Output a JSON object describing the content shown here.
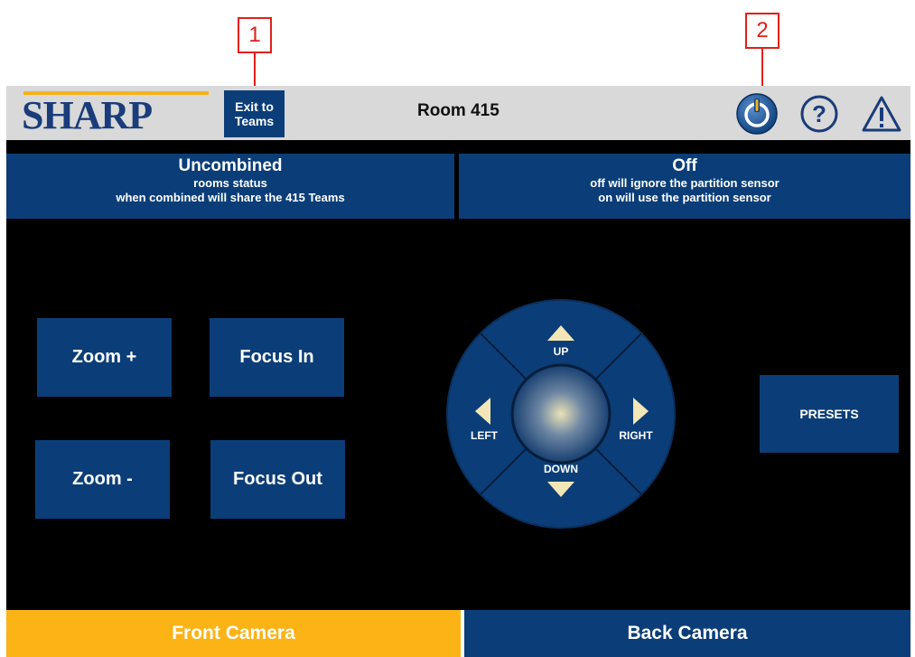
{
  "callouts": [
    "1",
    "2"
  ],
  "header": {
    "logo": "SHARP",
    "exit_line1": "Exit to",
    "exit_line2": "Teams",
    "room": "Room 415",
    "icons": [
      "power-icon",
      "help-icon",
      "warning-icon"
    ]
  },
  "status_left": {
    "title": "Uncombined",
    "line1": "rooms status",
    "line2": "when combined will share the 415 Teams"
  },
  "status_right": {
    "title": "Off",
    "line1": "off will ignore the partition sensor",
    "line2": "on will use the partition sensor"
  },
  "controls": {
    "zoom_in": "Zoom +",
    "focus_in": "Focus In",
    "zoom_out": "Zoom -",
    "focus_out": "Focus Out",
    "presets": "PRESETS"
  },
  "dpad": {
    "up": "UP",
    "down": "DOWN",
    "left": "LEFT",
    "right": "RIGHT"
  },
  "tabs": {
    "front": "Front Camera",
    "back": "Back Camera"
  },
  "colors": {
    "accent_blue": "#0b3e78",
    "accent_yellow": "#fbb316",
    "callout_red": "#e0201a"
  }
}
